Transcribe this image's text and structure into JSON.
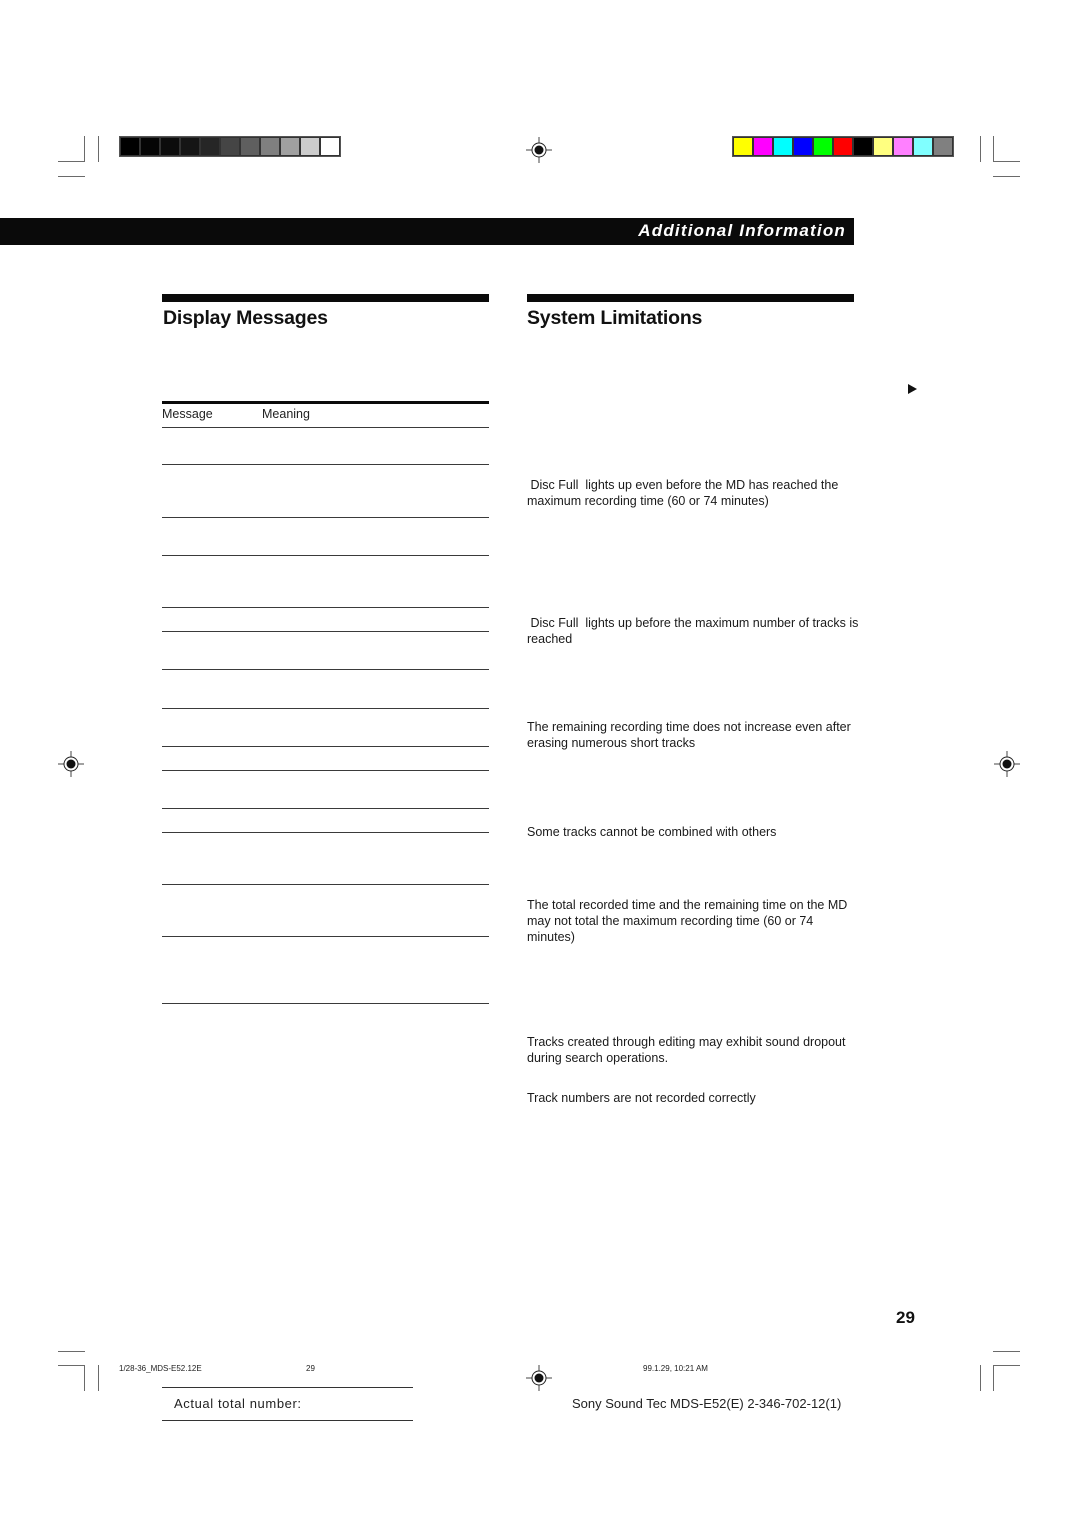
{
  "color_bars": {
    "grayscale": [
      "#000000",
      "#050505",
      "#0c0c0c",
      "#151515",
      "#262626",
      "#454545",
      "#5f5f5f",
      "#7f7f7f",
      "#a0a0a0",
      "#cccccc",
      "#ffffff"
    ],
    "process": [
      "#ffff00",
      "#ff00ff",
      "#00ffff",
      "#0000ff",
      "#00ff00",
      "#ff0000",
      "#000000",
      "#ffff80",
      "#ff80ff",
      "#80ffff",
      "#808080"
    ]
  },
  "header": {
    "section_label": "Additional Information"
  },
  "left_column": {
    "title": "Display Messages",
    "table": {
      "columns": [
        "Message",
        "Meaning"
      ],
      "row_count": 14
    }
  },
  "right_column": {
    "title": "System Limitations",
    "continued_marker": "continued-arrow",
    "paragraphs": [
      " Disc Full  lights up even before the MD has reached the maximum recording time (60 or 74 minutes)",
      " Disc Full  lights up before the maximum number of tracks is reached",
      "The remaining recording time does not increase even after erasing numerous short tracks",
      "Some tracks cannot be combined with others",
      "The total recorded time and the remaining time on the MD may not total the maximum recording time (60 or 74 minutes)",
      "Tracks created through editing may exhibit sound dropout during search operations.",
      "Track numbers are not recorded correctly"
    ]
  },
  "page_number": "29",
  "slug": {
    "file": "1/28-36_MDS-E52.12E",
    "page": "29",
    "timestamp": "99.1.29, 10:21 AM"
  },
  "footer": {
    "actual_total_label": "Actual total number:",
    "product_code": "Sony Sound Tec MDS-E52(E) 2-346-702-12(1)"
  }
}
